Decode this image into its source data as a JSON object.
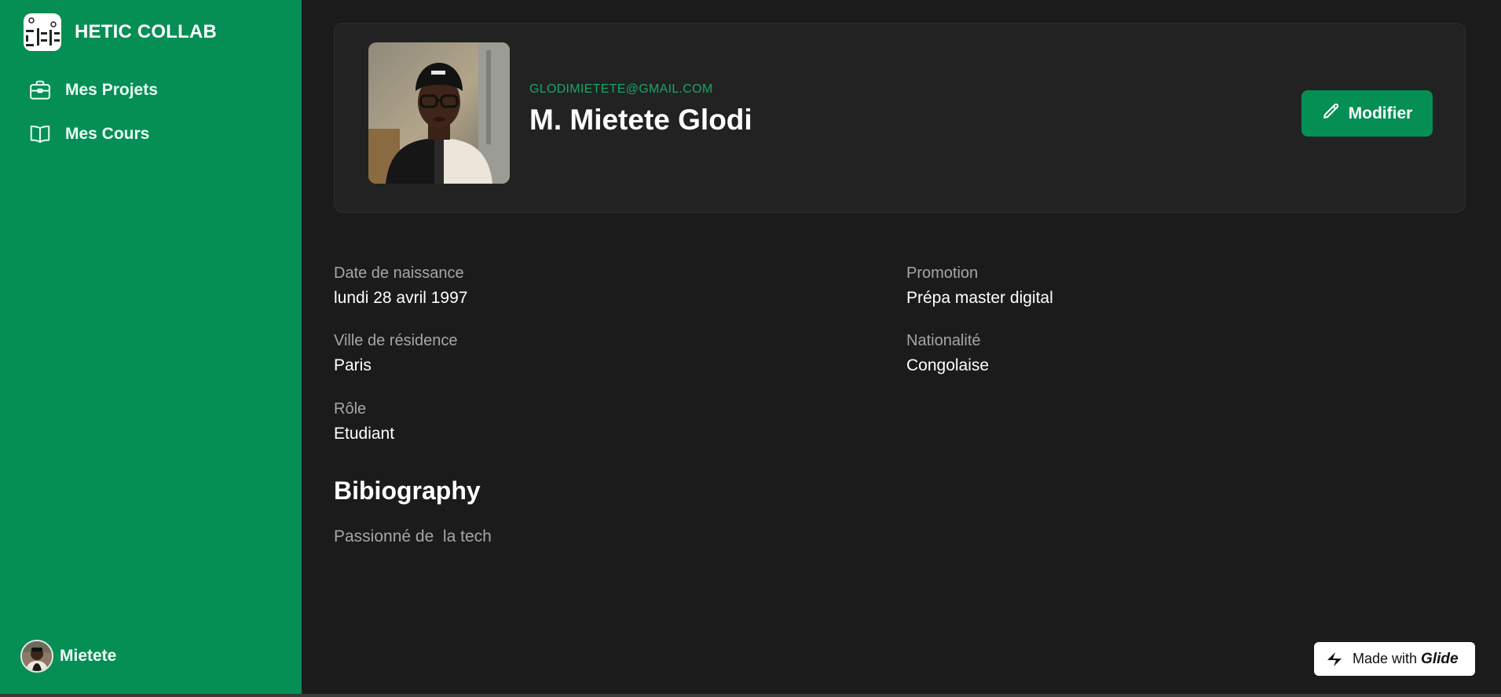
{
  "sidebar": {
    "brand_title": "HETIC COLLAB",
    "items": [
      {
        "label": "Mes Projets",
        "icon": "briefcase-icon"
      },
      {
        "label": "Mes Cours",
        "icon": "book-open-icon"
      }
    ],
    "user": {
      "name": "Mietete",
      "icon": "avatar"
    }
  },
  "profile": {
    "email": "GLODIMIETETE@GMAIL.COM",
    "name": "M. Mietete Glodi",
    "edit_label": "Modifier",
    "edit_icon": "pencil-icon"
  },
  "fields": {
    "birth": {
      "label": "Date de naissance",
      "value": "lundi 28 avril 1997"
    },
    "promo": {
      "label": "Promotion",
      "value": "Prépa master digital"
    },
    "city": {
      "label": "Ville de résidence",
      "value": "Paris"
    },
    "nationality": {
      "label": "Nationalité",
      "value": "Congolaise"
    },
    "role": {
      "label": "Rôle",
      "value": "Etudiant"
    }
  },
  "bio": {
    "title": "Bibiography",
    "text": "Passionné de  la tech"
  },
  "badge": {
    "text": "Made with",
    "brand": "Glide",
    "icon": "glide-bolt-icon"
  },
  "colors": {
    "accent": "#058f55",
    "email": "#1aa566",
    "background": "#1b1b1b",
    "card": "#222222",
    "muted": "#a6a6a6"
  }
}
